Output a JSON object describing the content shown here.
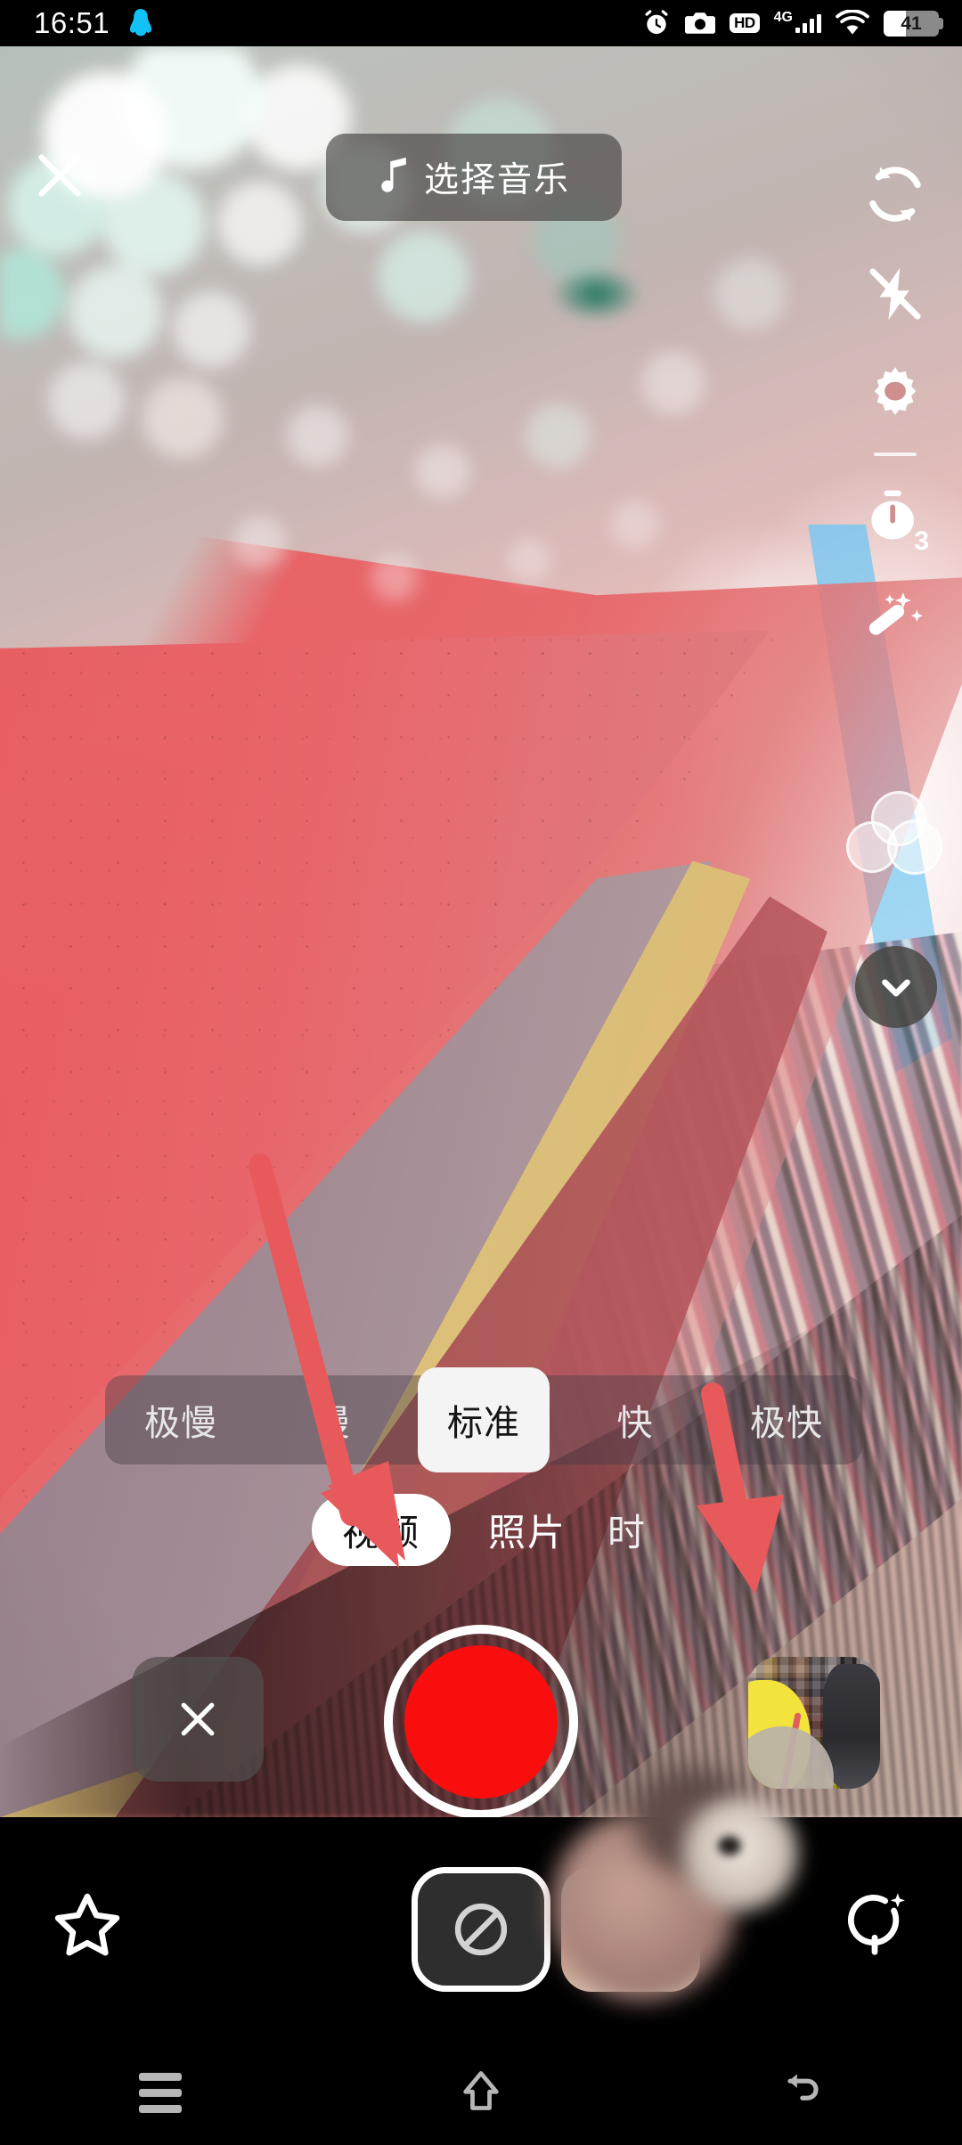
{
  "status_bar": {
    "time": "16:51",
    "left_icons": [
      "qq-penguin-icon"
    ],
    "right_icons": [
      "alarm-clock-icon",
      "camera-icon",
      "hd-icon",
      "signal-4g-icon",
      "wifi-icon",
      "battery-icon"
    ],
    "hd_label": "HD",
    "network_label": "4G",
    "battery_percent": "41",
    "battery_level": 41
  },
  "top_bar": {
    "close_label": "×",
    "music_button_label": "选择音乐",
    "music_icon": "music-note-icon",
    "flip_camera_icon": "flip-camera-icon"
  },
  "right_rail": {
    "items": [
      {
        "name": "flip-camera",
        "icon": "flip-camera-icon"
      },
      {
        "name": "flash",
        "icon": "flash-off-icon"
      },
      {
        "name": "settings",
        "icon": "gear-icon"
      },
      {
        "name": "timer",
        "icon": "timer-icon",
        "badge": "3"
      },
      {
        "name": "beauty",
        "icon": "magic-wand-icon"
      },
      {
        "name": "filters",
        "icon": "filter-circles-icon"
      },
      {
        "name": "collapse",
        "icon": "chevron-down-icon"
      }
    ],
    "timer_value": "3"
  },
  "speed_selector": {
    "options": [
      {
        "label": "极慢",
        "selected": false
      },
      {
        "label": "慢",
        "selected": false
      },
      {
        "label": "标准",
        "selected": true
      },
      {
        "label": "快",
        "selected": false
      },
      {
        "label": "极快",
        "selected": false
      }
    ],
    "selected": "标准"
  },
  "mode_selector": {
    "modes": [
      {
        "label": "视频",
        "selected": true
      },
      {
        "label": "照片",
        "selected": false
      },
      {
        "label": "时",
        "selected": false
      }
    ],
    "selected": "视频"
  },
  "capture_row": {
    "delete_label": "×",
    "delete_icon": "close-icon",
    "shutter_color": "#fa0d0d",
    "shutter_name": "record-button",
    "gallery_name": "gallery-thumbnail"
  },
  "effects_bar": {
    "favorite_icon": "star-icon",
    "none_effect_icon": "no-effect-icon",
    "effect_thumb_name": "effect-thumbnail",
    "search_icon": "search-sparkle-icon"
  },
  "annotations": {
    "arrow_color": "#e8595c",
    "arrows": [
      {
        "name": "arrow-to-record-button",
        "points_to": "record-button"
      },
      {
        "name": "arrow-to-gallery-thumbnail",
        "points_to": "gallery-thumbnail"
      }
    ]
  },
  "nav_bar": {
    "buttons": [
      {
        "name": "recents",
        "icon": "menu-icon"
      },
      {
        "name": "home",
        "icon": "home-icon"
      },
      {
        "name": "back",
        "icon": "back-icon"
      }
    ]
  },
  "colors": {
    "accent_red": "#fa0d0d",
    "annotation_red": "#e8595c",
    "bar_black": "#000000",
    "chrome_grey": "rgba(62,58,58,.62)"
  }
}
